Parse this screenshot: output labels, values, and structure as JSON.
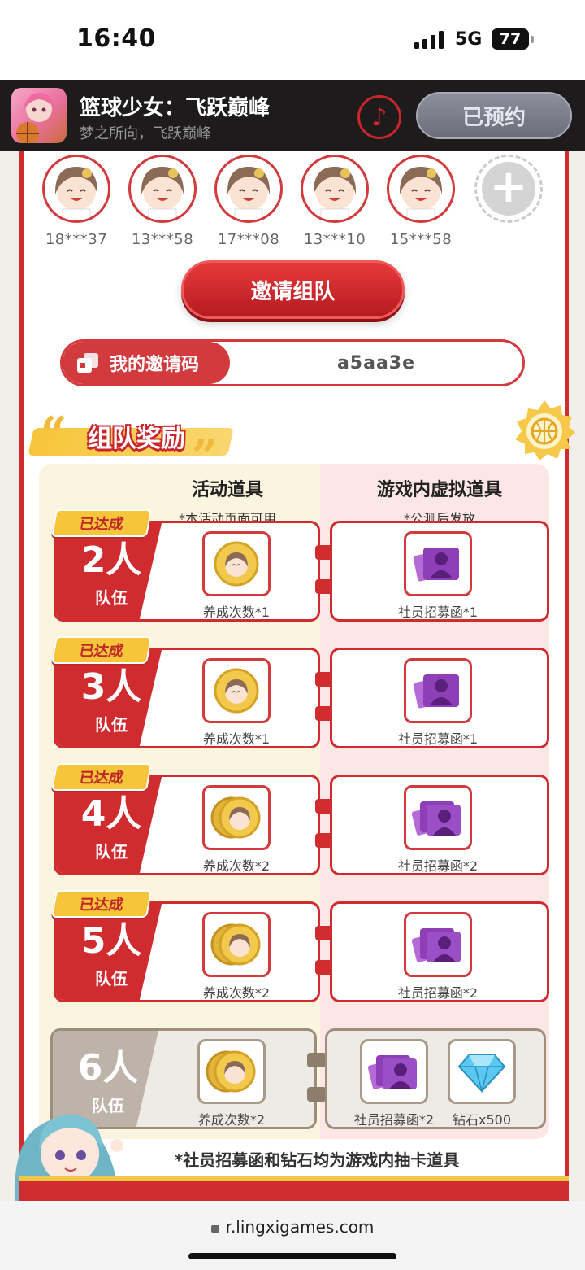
{
  "status": {
    "time": "16:40",
    "network": "5G",
    "battery": "77"
  },
  "banner": {
    "title": "篮球少女：飞跃巅峰",
    "subtitle": "梦之所向，飞跃巅峰",
    "reserve_label": "已预约"
  },
  "members": [
    "18***37",
    "13***58",
    "17***08",
    "13***10",
    "15***58"
  ],
  "invite_button": "邀请组队",
  "invite_code": {
    "label": "我的邀请码",
    "value": "a5aa3e"
  },
  "section_title": "组队奖励",
  "columns": {
    "left": {
      "title": "活动道具",
      "note": "*本活动页面可用"
    },
    "right": {
      "title": "游戏内虚拟道具",
      "note": "*公测后发放"
    }
  },
  "tiers": [
    {
      "badge": "已达成",
      "people": "2人",
      "team": "队伍",
      "left_item": "养成次数*1",
      "right_item": "社员招募函*1"
    },
    {
      "badge": "已达成",
      "people": "3人",
      "team": "队伍",
      "left_item": "养成次数*1",
      "right_item": "社员招募函*1"
    },
    {
      "badge": "已达成",
      "people": "4人",
      "team": "队伍",
      "left_item": "养成次数*2",
      "right_item": "社员招募函*2"
    },
    {
      "badge": "已达成",
      "people": "5人",
      "team": "队伍",
      "left_item": "养成次数*2",
      "right_item": "社员招募函*2"
    }
  ],
  "tier6": {
    "people": "6人",
    "team": "队伍",
    "left_item": "养成次数*2",
    "right_item_1": "社员招募函*2",
    "right_item_2": "钻石x500"
  },
  "footnote": "*社员招募函和钻石均为游戏内抽卡道具",
  "url": "r.lingxigames.com",
  "colors": {
    "brand_red": "#d02c30",
    "gold": "#f7c53a",
    "gray": "#bdb3a8"
  }
}
